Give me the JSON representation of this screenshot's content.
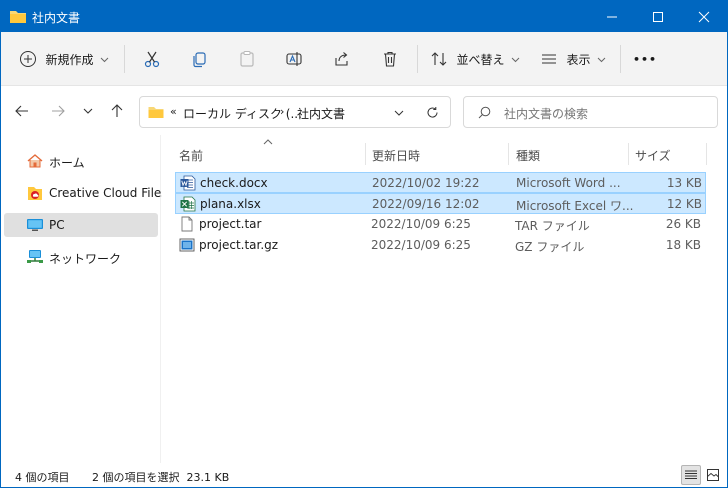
{
  "window": {
    "title": "社内文書",
    "accent": "#0067c0"
  },
  "toolbar": {
    "new_label": "新規作成",
    "sort_label": "並べ替え",
    "view_label": "表示",
    "more_label": "•••"
  },
  "address": {
    "prefix": "«",
    "segments": [
      "ローカル ディスク (...",
      "社内文書"
    ],
    "separator": "›"
  },
  "search": {
    "placeholder": "社内文書の検索"
  },
  "sidebar": {
    "items": [
      {
        "label": "ホーム",
        "icon": "home-icon"
      },
      {
        "label": "Creative Cloud Files",
        "icon": "creative-cloud-folder-icon"
      },
      {
        "label": "PC",
        "icon": "pc-icon",
        "selected": true
      },
      {
        "label": "ネットワーク",
        "icon": "network-icon"
      }
    ]
  },
  "columns": {
    "name": "名前",
    "modified": "更新日時",
    "type": "種類",
    "size": "サイズ"
  },
  "files": [
    {
      "name": "check.docx",
      "modified": "2022/10/02 19:22",
      "type": "Microsoft Word ...",
      "size": "13 KB",
      "icon": "word-document-icon",
      "selected": true
    },
    {
      "name": "plana.xlsx",
      "modified": "2022/09/16 12:02",
      "type": "Microsoft Excel ワ...",
      "size": "12 KB",
      "icon": "excel-workbook-icon",
      "selected": true
    },
    {
      "name": "project.tar",
      "modified": "2022/10/09 6:25",
      "type": "TAR ファイル",
      "size": "26 KB",
      "icon": "blank-file-icon",
      "selected": false
    },
    {
      "name": "project.tar.gz",
      "modified": "2022/10/09 6:25",
      "type": "GZ ファイル",
      "size": "18 KB",
      "icon": "archive-file-icon",
      "selected": false
    }
  ],
  "status": {
    "item_count": "4 個の項目",
    "selection": "2 個の項目を選択  23.1 KB"
  }
}
